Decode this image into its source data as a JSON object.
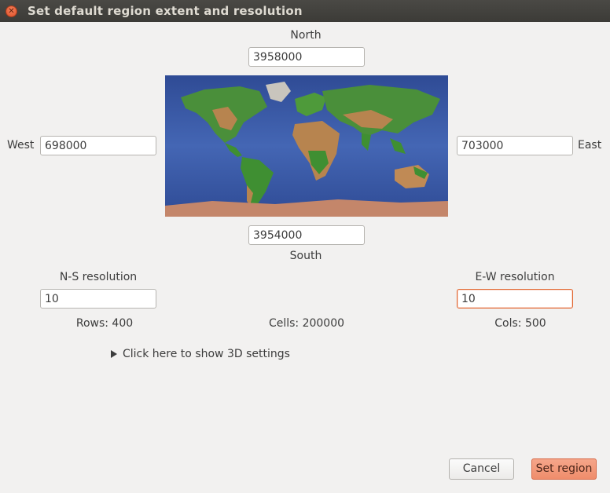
{
  "window": {
    "title": "Set default region extent and resolution"
  },
  "extent": {
    "north_label": "North",
    "north_value": "3958000",
    "south_label": "South",
    "south_value": "3954000",
    "west_label": "West",
    "west_value": "698000",
    "east_label": "East",
    "east_value": "703000"
  },
  "resolution": {
    "ns_label": "N-S resolution",
    "ns_value": "10",
    "ew_label": "E-W resolution",
    "ew_value": "10"
  },
  "stats": {
    "rows": "Rows: 400",
    "cells": "Cells: 200000",
    "cols": "Cols: 500"
  },
  "settings3d": {
    "label": "Click here to show 3D settings"
  },
  "buttons": {
    "cancel": "Cancel",
    "set_region": "Set region"
  },
  "colors": {
    "accent": "#e9652f",
    "ocean": "#3c5aa8",
    "land_green": "#3f8f32",
    "land_brown": "#b77a4a"
  }
}
